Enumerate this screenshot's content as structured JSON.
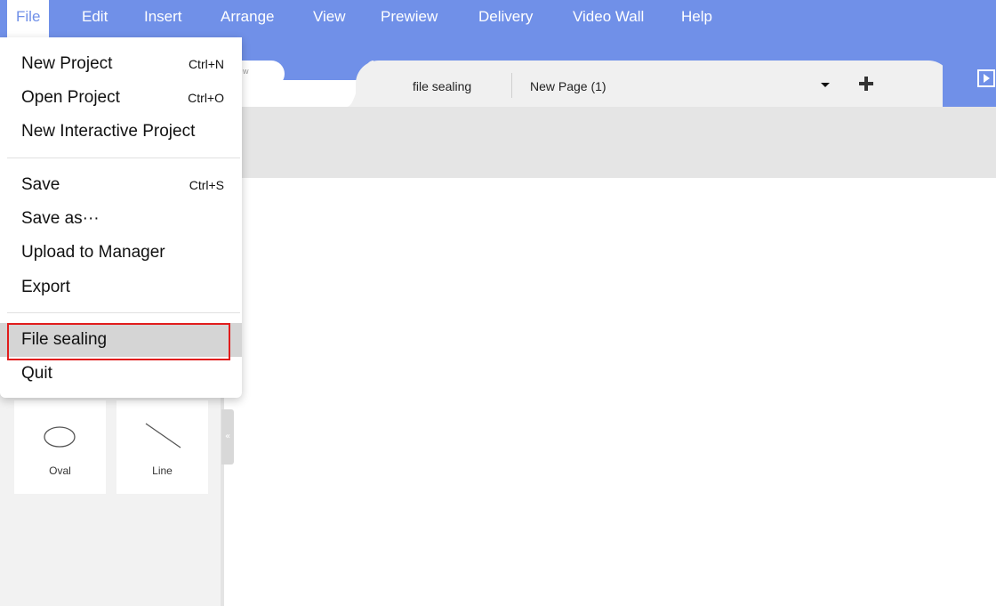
{
  "menubar": {
    "items": [
      {
        "label": "File",
        "active": true
      },
      {
        "label": "Edit"
      },
      {
        "label": "Insert"
      },
      {
        "label": "Arrange"
      },
      {
        "label": "View"
      },
      {
        "label": "Prewiew"
      },
      {
        "label": "Delivery"
      },
      {
        "label": "Video Wall"
      },
      {
        "label": "Help"
      }
    ]
  },
  "file_menu": {
    "items": [
      {
        "label": "New Project",
        "shortcut": "Ctrl+N"
      },
      {
        "label": "Open Project",
        "shortcut": "Ctrl+O"
      },
      {
        "label": "New Interactive Project",
        "shortcut": ""
      },
      {
        "label": "Save",
        "shortcut": "Ctrl+S"
      },
      {
        "label": "Save as···",
        "shortcut": ""
      },
      {
        "label": "Upload to Manager",
        "shortcut": ""
      },
      {
        "label": "Export",
        "shortcut": ""
      },
      {
        "label": "File sealing",
        "shortcut": "",
        "highlighted": true
      },
      {
        "label": "Quit",
        "shortcut": ""
      }
    ]
  },
  "tabs": {
    "project_name": "file sealing",
    "page_name": "New Page (1)"
  },
  "shapes_panel": {
    "items": [
      {
        "label": "Oval",
        "icon": "oval-icon"
      },
      {
        "label": "Line",
        "icon": "line-icon"
      }
    ]
  },
  "pill_fragment": "w",
  "colors": {
    "accent": "#7090e8",
    "highlight_border": "#e11d1d",
    "hover_background": "#d5d5d5"
  }
}
